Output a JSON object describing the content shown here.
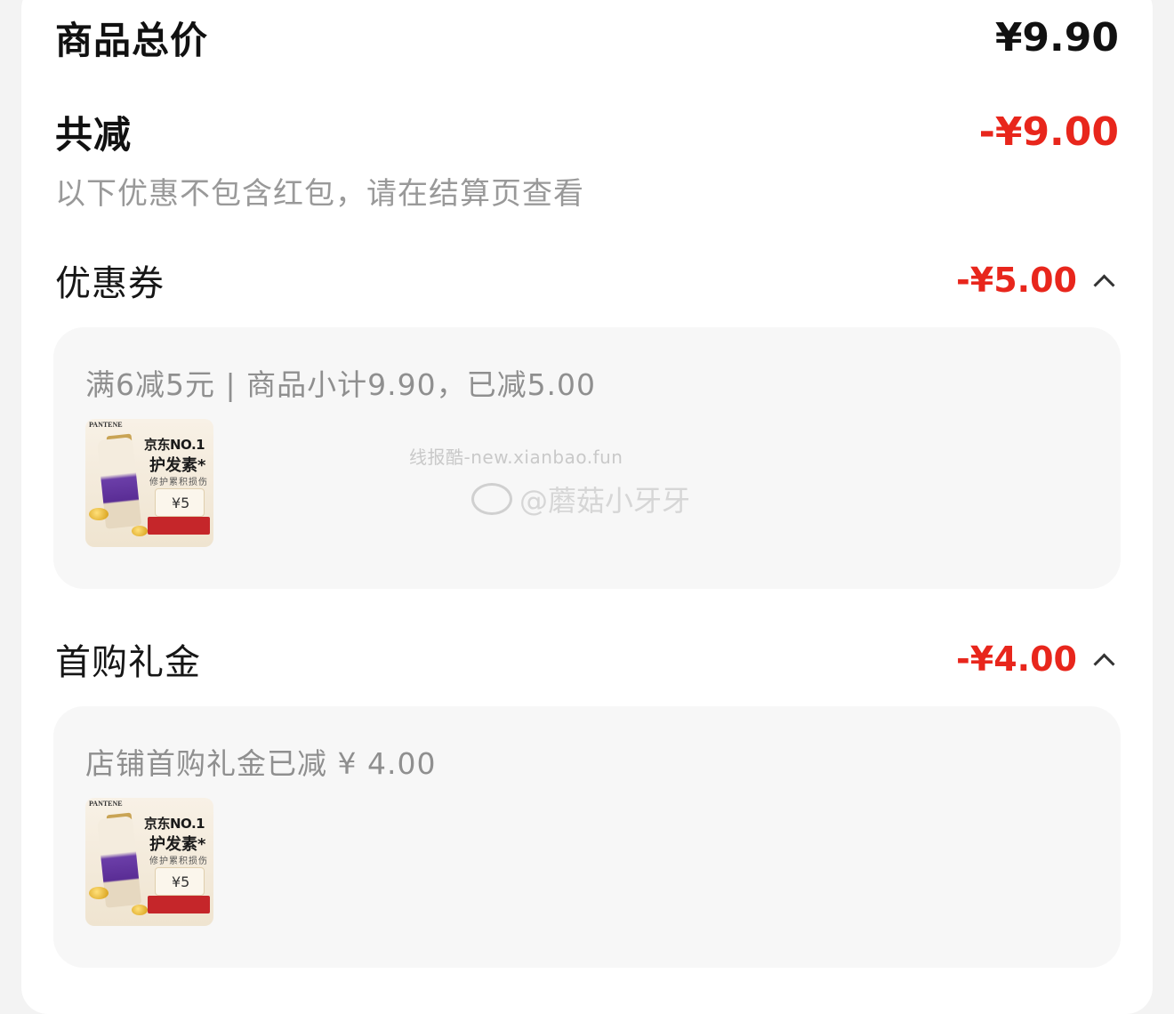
{
  "summary": {
    "total_label": "商品总价",
    "total_value": "¥9.90",
    "discount_label": "共减",
    "discount_value": "-¥9.00",
    "note": "以下优惠不包含红包，请在结算页查看"
  },
  "coupon": {
    "label": "优惠券",
    "value": "-¥5.00",
    "detail": "满6减5元 | 商品小计9.90，已减5.00",
    "icon": "chevron-up-icon"
  },
  "first_gift": {
    "label": "首购礼金",
    "value": "-¥4.00",
    "detail": "店铺首购礼金已减 ¥ 4.00",
    "icon": "chevron-up-icon"
  },
  "product_thumb": {
    "brand": "PANTENE",
    "line1": "京东NO.1",
    "line2": "护发素*",
    "line3": "修护累积损伤",
    "badge": "¥5"
  },
  "watermarks": {
    "site": "线报酷-new.xianbao.fun",
    "weibo": "@蘑菇小牙牙"
  },
  "colors": {
    "accent_red": "#e8261c",
    "panel_bg": "#f7f7f7"
  }
}
